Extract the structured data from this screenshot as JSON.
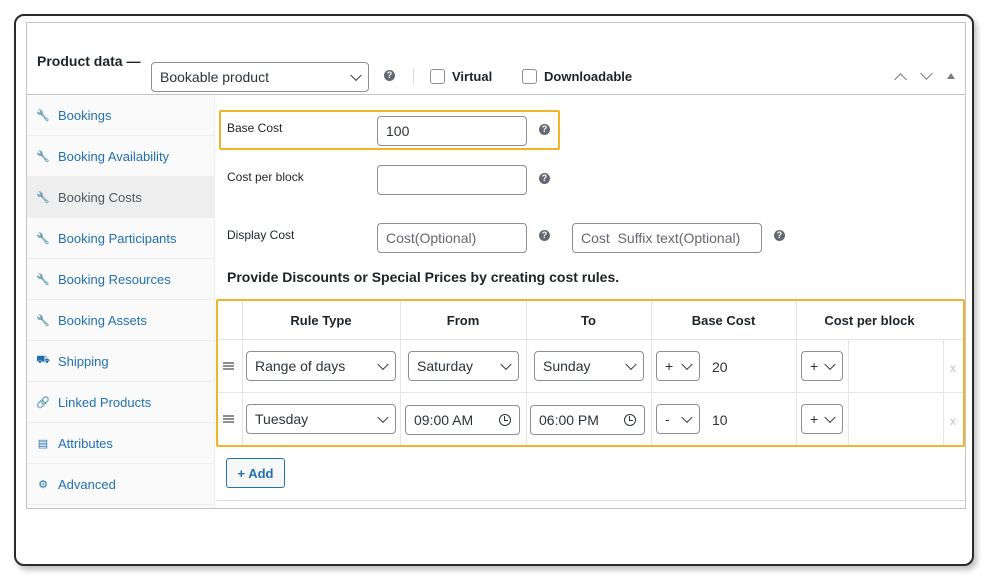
{
  "header": {
    "label": "Product data —",
    "product_type": "Bookable product",
    "virtual_label": "Virtual",
    "downloadable_label": "Downloadable",
    "help_glyph": "?"
  },
  "sidebar": {
    "items": [
      {
        "label": "Bookings",
        "icon": "wrench-icon"
      },
      {
        "label": "Booking Availability",
        "icon": "wrench-icon"
      },
      {
        "label": "Booking Costs",
        "icon": "wrench-icon",
        "active": true
      },
      {
        "label": "Booking Participants",
        "icon": "wrench-icon"
      },
      {
        "label": "Booking Resources",
        "icon": "wrench-icon"
      },
      {
        "label": "Booking Assets",
        "icon": "wrench-icon"
      },
      {
        "label": "Shipping",
        "icon": "truck-icon"
      },
      {
        "label": "Linked Products",
        "icon": "link-icon"
      },
      {
        "label": "Attributes",
        "icon": "list-icon"
      },
      {
        "label": "Advanced",
        "icon": "gear-icon"
      }
    ]
  },
  "fields": {
    "base_cost": {
      "label": "Base Cost",
      "value": "100"
    },
    "cost_per_block": {
      "label": "Cost per block",
      "value": ""
    },
    "display_cost": {
      "label": "Display Cost",
      "placeholder": "Cost(Optional)",
      "suffix_placeholder": "Cost  Suffix text(Optional)"
    }
  },
  "rules": {
    "title": "Provide Discounts or Special Prices by creating cost rules.",
    "headers": [
      "Rule Type",
      "From",
      "To",
      "Base Cost",
      "Cost per block"
    ],
    "rows": [
      {
        "rule_type": "Range of days",
        "from": "Saturday",
        "to": "Sunday",
        "base_modifier": "+",
        "base_cost": "20",
        "block_modifier": "+",
        "block_cost": "",
        "delete": "x"
      },
      {
        "rule_type": "Tuesday",
        "from": "09:00 AM",
        "to": "06:00 PM",
        "base_modifier": "-",
        "base_cost": "10",
        "block_modifier": "+",
        "block_cost": "",
        "delete": "x"
      }
    ],
    "add_label": "+ Add"
  },
  "colors": {
    "accent": "#2271b1",
    "highlight": "#f0b429"
  }
}
